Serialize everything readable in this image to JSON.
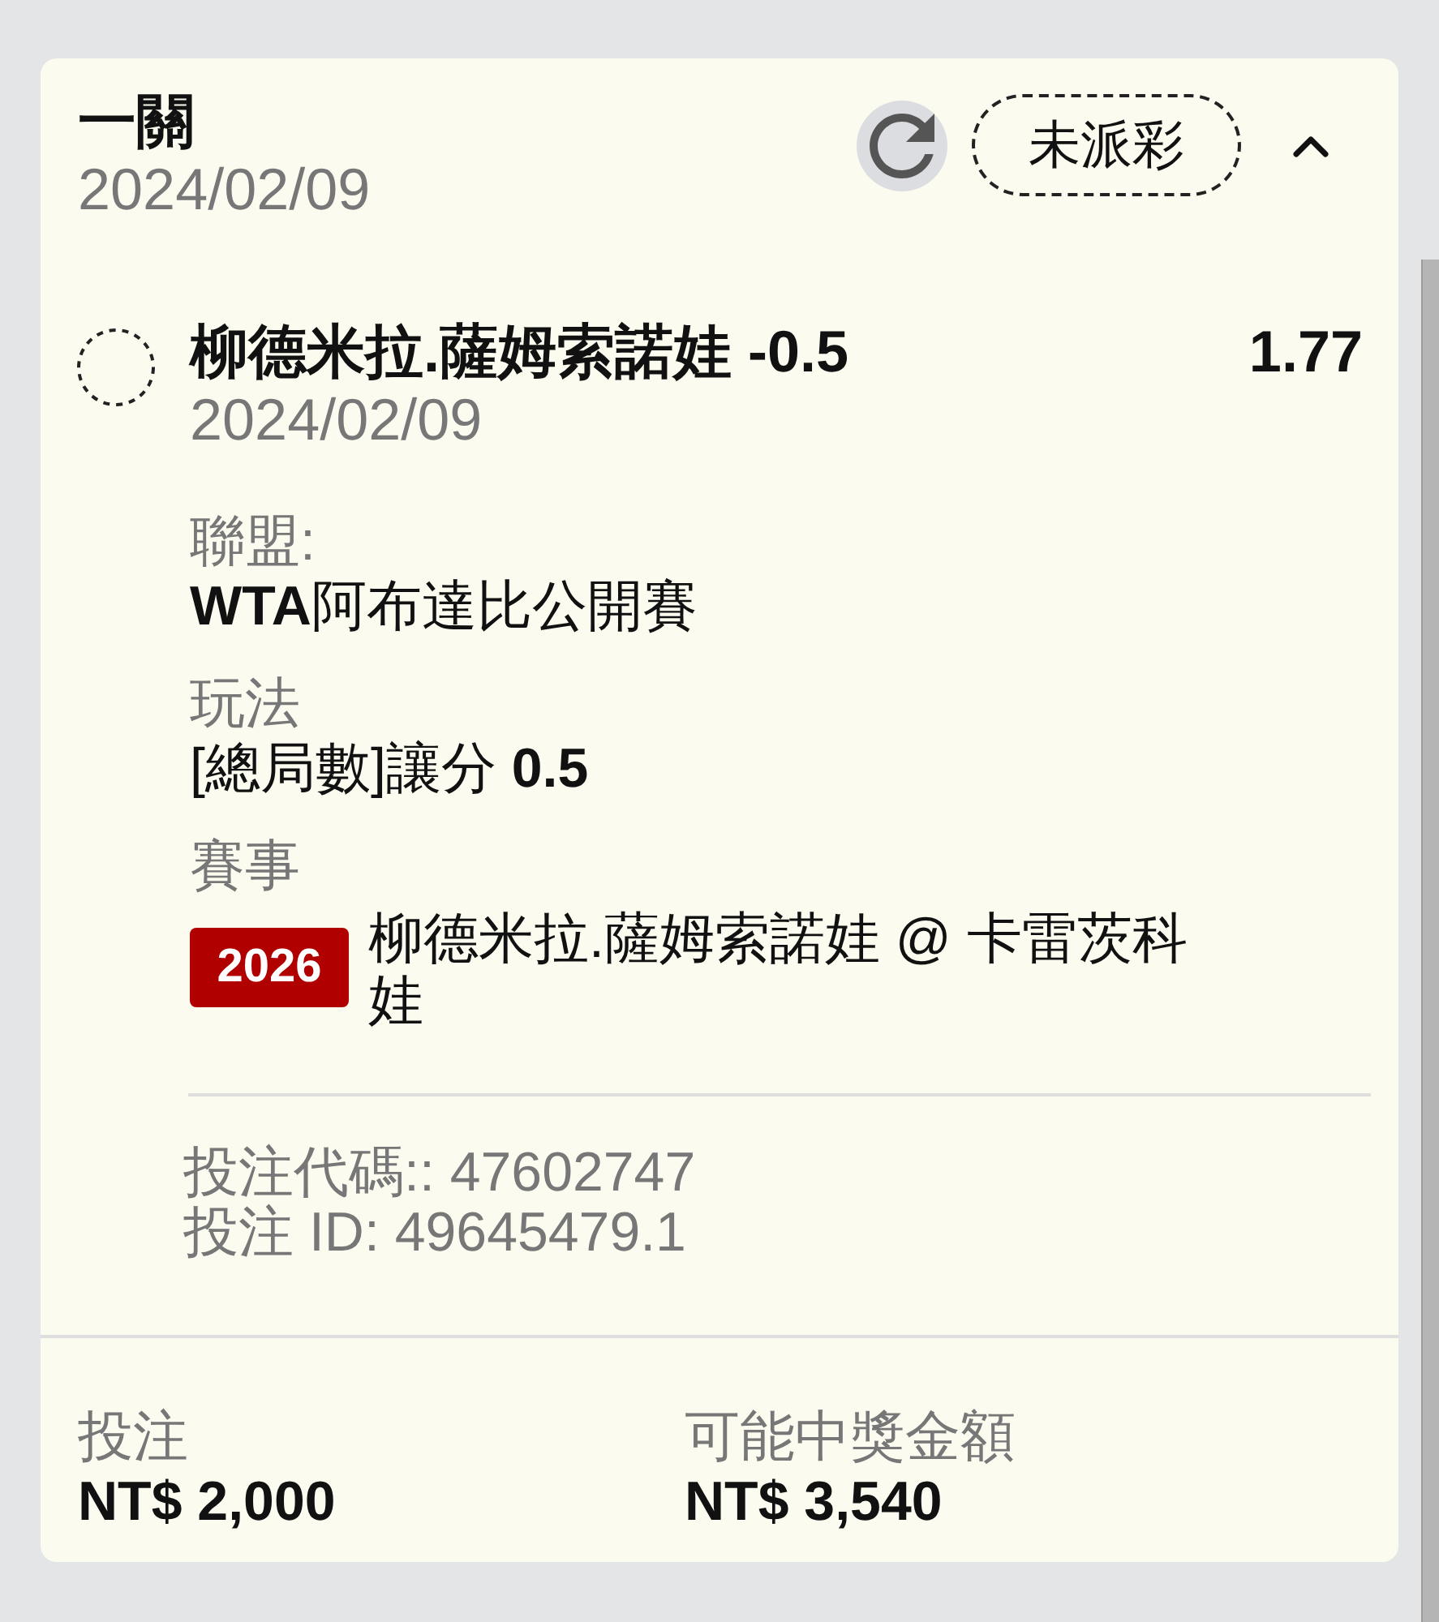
{
  "ticket": {
    "title": "一關",
    "date": "2024/02/09",
    "status": "未派彩",
    "expanded": true
  },
  "selection": {
    "settled": false,
    "name": "柳德米拉.薩姆索諾娃 -0.5",
    "odds": "1.77",
    "date": "2024/02/09"
  },
  "details": [
    {
      "label": "聯盟:",
      "value": "**WTA**阿布達比公開賽"
    },
    {
      "label": "玩法",
      "value": "[總局數]讓分 **0.5**"
    },
    {
      "label": "賽事",
      "tag": "2026",
      "value": "柳德米拉.薩姆索諾娃 @ 卡雷茨科娃"
    }
  ],
  "references": [
    "投注代碼:: 47602747",
    "投注 ID: 49645479.1"
  ],
  "summary": [
    {
      "label": "投注",
      "value": "NT$ 2,000"
    },
    {
      "label": "可能中獎金額",
      "value": "NT$ 3,540"
    }
  ]
}
